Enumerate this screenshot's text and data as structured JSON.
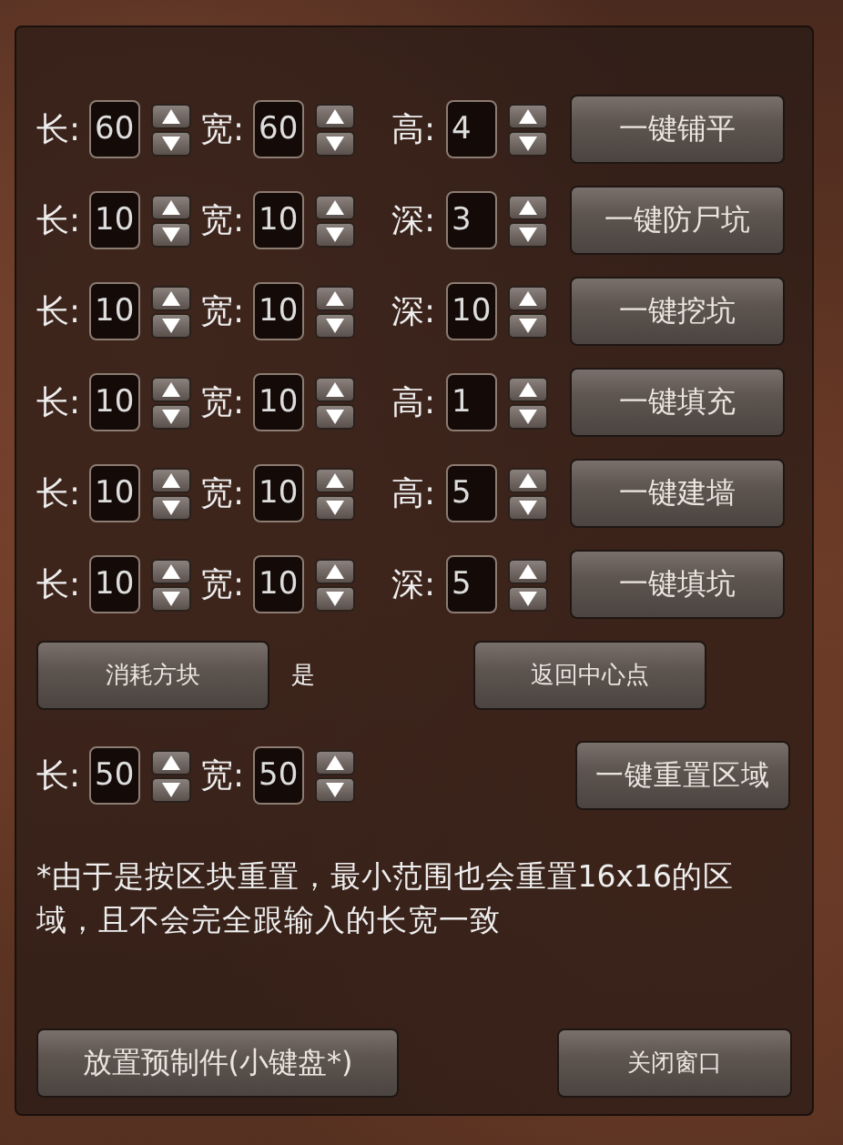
{
  "rows": [
    {
      "fields": [
        {
          "label": "长:",
          "value": "60"
        },
        {
          "label": "宽:",
          "value": "60"
        },
        {
          "label": "高:",
          "value": "4"
        }
      ],
      "action": "一键铺平"
    },
    {
      "fields": [
        {
          "label": "长:",
          "value": "10"
        },
        {
          "label": "宽:",
          "value": "10"
        },
        {
          "label": "深:",
          "value": "3"
        }
      ],
      "action": "一键防尸坑"
    },
    {
      "fields": [
        {
          "label": "长:",
          "value": "10"
        },
        {
          "label": "宽:",
          "value": "10"
        },
        {
          "label": "深:",
          "value": "10"
        }
      ],
      "action": "一键挖坑"
    },
    {
      "fields": [
        {
          "label": "长:",
          "value": "10"
        },
        {
          "label": "宽:",
          "value": "10"
        },
        {
          "label": "高:",
          "value": "1"
        }
      ],
      "action": "一键填充"
    },
    {
      "fields": [
        {
          "label": "长:",
          "value": "10"
        },
        {
          "label": "宽:",
          "value": "10"
        },
        {
          "label": "高:",
          "value": "5"
        }
      ],
      "action": "一键建墙"
    },
    {
      "fields": [
        {
          "label": "长:",
          "value": "10"
        },
        {
          "label": "宽:",
          "value": "10"
        },
        {
          "label": "深:",
          "value": "5"
        }
      ],
      "action": "一键填坑"
    }
  ],
  "consume": {
    "button": "消耗方块",
    "value": "是"
  },
  "center_button": "返回中心点",
  "reset": {
    "fields": [
      {
        "label": "长:",
        "value": "50"
      },
      {
        "label": "宽:",
        "value": "50"
      }
    ],
    "action": "一键重置区域"
  },
  "note": "*由于是按区块重置，最小范围也会重置16x16的区域，且不会完全跟输入的长宽一致",
  "footer": {
    "place_button": "放置预制件(小键盘*)",
    "close_button": "关闭窗口"
  }
}
